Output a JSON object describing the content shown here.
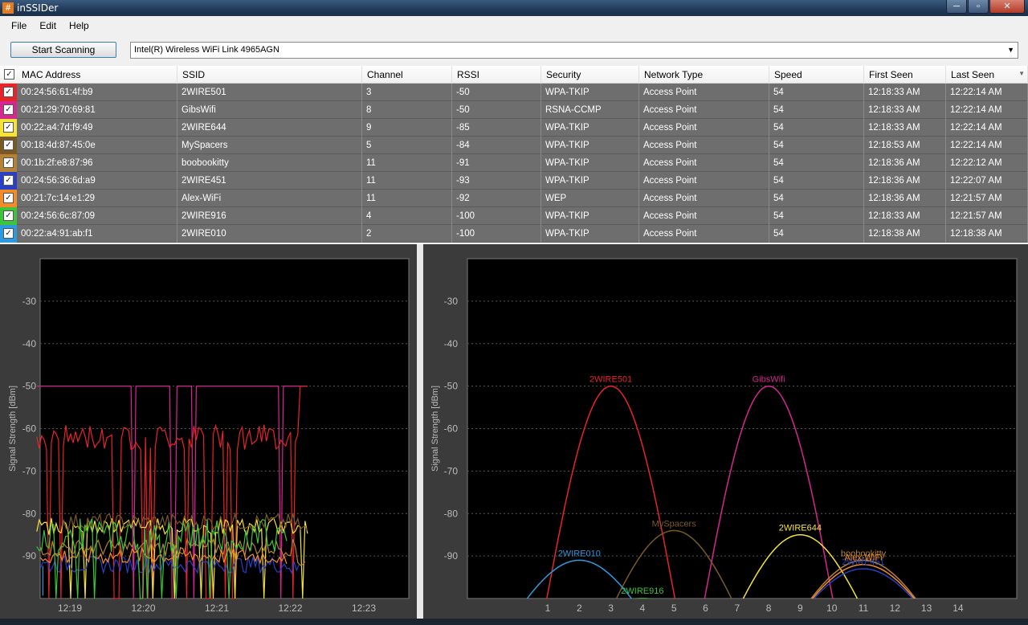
{
  "window": {
    "title": "inSSIDer",
    "icon": "app-hash-icon",
    "minimize": "─",
    "maximize": "▫",
    "close": "✕"
  },
  "menu": [
    "File",
    "Edit",
    "Help"
  ],
  "toolbar": {
    "scan_button": "Start Scanning",
    "adapter": "Intel(R) Wireless WiFi Link 4965AGN"
  },
  "table": {
    "columns": [
      "MAC Address",
      "SSID",
      "Channel",
      "RSSI",
      "Security",
      "Network Type",
      "Speed",
      "First Seen",
      "Last Seen"
    ],
    "rows": [
      {
        "color": "#e8232a",
        "mac": "00:24:56:61:4f:b9",
        "ssid": "2WIRE501",
        "channel": "3",
        "rssi": "-50",
        "security": "WPA-TKIP",
        "type": "Access Point",
        "speed": "54",
        "first": "12:18:33 AM",
        "last": "12:22:14 AM"
      },
      {
        "color": "#d6268f",
        "mac": "00:21:29:70:69:81",
        "ssid": "GibsWifi",
        "channel": "8",
        "rssi": "-50",
        "security": "RSNA-CCMP",
        "type": "Access Point",
        "speed": "54",
        "first": "12:18:33 AM",
        "last": "12:22:14 AM"
      },
      {
        "color": "#f5e337",
        "mac": "00:22:a4:7d:f9:49",
        "ssid": "2WIRE644",
        "channel": "9",
        "rssi": "-85",
        "security": "WPA-TKIP",
        "type": "Access Point",
        "speed": "54",
        "first": "12:18:33 AM",
        "last": "12:22:14 AM"
      },
      {
        "color": "#7a5a22",
        "mac": "00:18:4d:87:45:0e",
        "ssid": "MySpacers",
        "channel": "5",
        "rssi": "-84",
        "security": "WPA-TKIP",
        "type": "Access Point",
        "speed": "54",
        "first": "12:18:53 AM",
        "last": "12:22:14 AM"
      },
      {
        "color": "#b48236",
        "mac": "00:1b:2f:e8:87:96",
        "ssid": "boobookitty",
        "channel": "11",
        "rssi": "-91",
        "security": "WPA-TKIP",
        "type": "Access Point",
        "speed": "54",
        "first": "12:18:36 AM",
        "last": "12:22:12 AM"
      },
      {
        "color": "#2a3fc8",
        "mac": "00:24:56:36:6d:a9",
        "ssid": "2WIRE451",
        "channel": "11",
        "rssi": "-93",
        "security": "WPA-TKIP",
        "type": "Access Point",
        "speed": "54",
        "first": "12:18:36 AM",
        "last": "12:22:07 AM"
      },
      {
        "color": "#f28c28",
        "mac": "00:21:7c:14:e1:29",
        "ssid": "Alex-WiFi",
        "channel": "11",
        "rssi": "-92",
        "security": "WEP",
        "type": "Access Point",
        "speed": "54",
        "first": "12:18:36 AM",
        "last": "12:21:57 AM"
      },
      {
        "color": "#3ec43a",
        "mac": "00:24:56:6c:87:09",
        "ssid": "2WIRE916",
        "channel": "4",
        "rssi": "-100",
        "security": "WPA-TKIP",
        "type": "Access Point",
        "speed": "54",
        "first": "12:18:33 AM",
        "last": "12:21:57 AM"
      },
      {
        "color": "#2a9be0",
        "mac": "00:22:a4:91:ab:f1",
        "ssid": "2WIRE010",
        "channel": "2",
        "rssi": "-100",
        "security": "WPA-TKIP",
        "type": "Access Point",
        "speed": "54",
        "first": "12:18:38 AM",
        "last": "12:18:38 AM"
      }
    ]
  },
  "chart_data": [
    {
      "type": "line",
      "ylabel": "Signal Strength [dBm]",
      "ylim": [
        -100,
        -20
      ],
      "yticks": [
        -30,
        -40,
        -50,
        -60,
        -70,
        -80,
        -90
      ],
      "xticks": [
        "12:19",
        "12:20",
        "12:21",
        "12:22",
        "12:23"
      ],
      "grid": true,
      "series": [
        {
          "name": "GibsWifi",
          "color": "#d6268f",
          "x": [
            "12:18:33",
            "12:22:14"
          ],
          "y": [
            -50,
            -50
          ]
        },
        {
          "name": "2WIRE501",
          "color": "#e8232a",
          "x": [
            "12:18:33",
            "12:22:14"
          ],
          "y": [
            -64,
            -50
          ]
        },
        {
          "name": "2WIRE644",
          "color": "#f5e337",
          "x": [
            "12:18:33",
            "12:22:14"
          ],
          "y": [
            -85,
            -85
          ]
        },
        {
          "name": "MySpacers",
          "color": "#7a5a22",
          "x": [
            "12:18:53",
            "12:22:14"
          ],
          "y": [
            -82,
            -84
          ]
        },
        {
          "name": "boobookitty",
          "color": "#b48236",
          "x": [
            "12:18:36",
            "12:22:12"
          ],
          "y": [
            -88,
            -91
          ]
        },
        {
          "name": "2WIRE451",
          "color": "#2a3fc8",
          "x": [
            "12:18:36",
            "12:22:07"
          ],
          "y": [
            -92,
            -93
          ]
        },
        {
          "name": "Alex-WiFi",
          "color": "#f28c28",
          "x": [
            "12:18:36",
            "12:21:57"
          ],
          "y": [
            -90,
            -92
          ]
        },
        {
          "name": "2WIRE916",
          "color": "#3ec43a",
          "x": [
            "12:18:33",
            "12:21:57"
          ],
          "y": [
            -85,
            -100
          ]
        },
        {
          "name": "2WIRE010",
          "color": "#2a9be0",
          "x": [
            "12:18:38",
            "12:18:38"
          ],
          "y": [
            -93,
            -100
          ]
        }
      ]
    },
    {
      "type": "area",
      "ylabel": "Signal Strength [dBm]",
      "ylim": [
        -100,
        -20
      ],
      "yticks": [
        -30,
        -40,
        -50,
        -60,
        -70,
        -80,
        -90
      ],
      "xticks": [
        "1",
        "2",
        "3",
        "4",
        "5",
        "6",
        "7",
        "8",
        "9",
        "10",
        "11",
        "12",
        "13",
        "14"
      ],
      "grid": true,
      "networks": [
        {
          "name": "2WIRE501",
          "channel": 3,
          "rssi": -50,
          "color": "#e8232a"
        },
        {
          "name": "GibsWifi",
          "channel": 8,
          "rssi": -50,
          "color": "#d6268f"
        },
        {
          "name": "2WIRE644",
          "channel": 9,
          "rssi": -85,
          "color": "#f5e337"
        },
        {
          "name": "MySpacers",
          "channel": 5,
          "rssi": -84,
          "color": "#7a5a22"
        },
        {
          "name": "boobookitty",
          "channel": 11,
          "rssi": -91,
          "color": "#b48236"
        },
        {
          "name": "2WIRE451",
          "channel": 11,
          "rssi": -93,
          "color": "#2a3fc8"
        },
        {
          "name": "Alex-WiFi",
          "channel": 11,
          "rssi": -92,
          "color": "#f28c28"
        },
        {
          "name": "2WIRE916",
          "channel": 4,
          "rssi": -100,
          "color": "#3ec43a"
        },
        {
          "name": "2WIRE010",
          "channel": 2,
          "rssi": -91,
          "color": "#2a9be0"
        }
      ]
    }
  ]
}
